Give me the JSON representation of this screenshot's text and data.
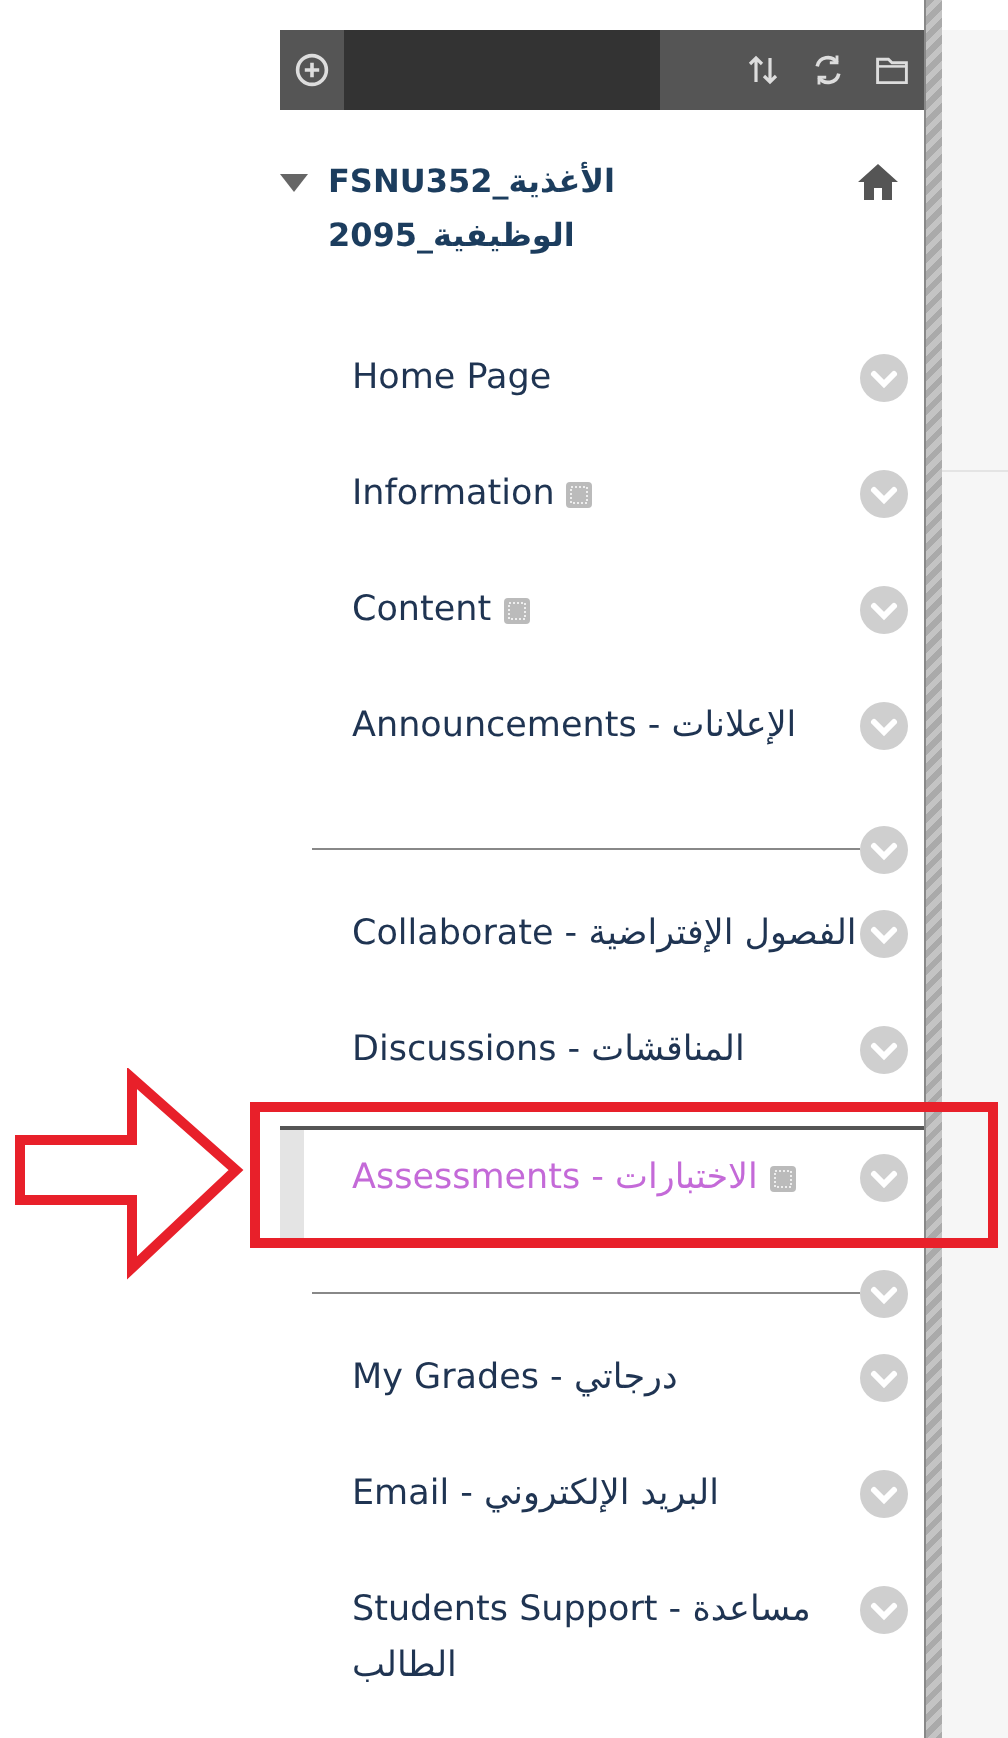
{
  "course": {
    "title": "FSNU352_الأغذية الوظيفية_2095",
    "expanded": true
  },
  "menu": [
    {
      "kind": "link",
      "label": "Home Page",
      "unavailable": false,
      "selected": false,
      "annotated": false
    },
    {
      "kind": "link",
      "label": "Information",
      "unavailable": true,
      "selected": false,
      "annotated": false
    },
    {
      "kind": "link",
      "label": "Content",
      "unavailable": true,
      "selected": false,
      "annotated": false
    },
    {
      "kind": "link",
      "label": "Announcements - الإعلانات",
      "unavailable": false,
      "selected": false,
      "annotated": false
    },
    {
      "kind": "divider"
    },
    {
      "kind": "link",
      "label": "Collaborate - الفصول الإفتراضية",
      "unavailable": false,
      "selected": false,
      "annotated": false
    },
    {
      "kind": "link",
      "label": "Discussions - المناقشات",
      "unavailable": false,
      "selected": false,
      "annotated": false
    },
    {
      "kind": "link",
      "label": "Assessments - الاختبارات",
      "unavailable": true,
      "selected": true,
      "annotated": true
    },
    {
      "kind": "divider"
    },
    {
      "kind": "link",
      "label": "My Grades - درجاتي",
      "unavailable": false,
      "selected": false,
      "annotated": false
    },
    {
      "kind": "link",
      "label": "Email - البريد الإلكتروني",
      "unavailable": false,
      "selected": false,
      "annotated": false
    },
    {
      "kind": "link",
      "label": "Students Support - مساعدة الطالب",
      "unavailable": false,
      "selected": false,
      "annotated": false
    }
  ]
}
